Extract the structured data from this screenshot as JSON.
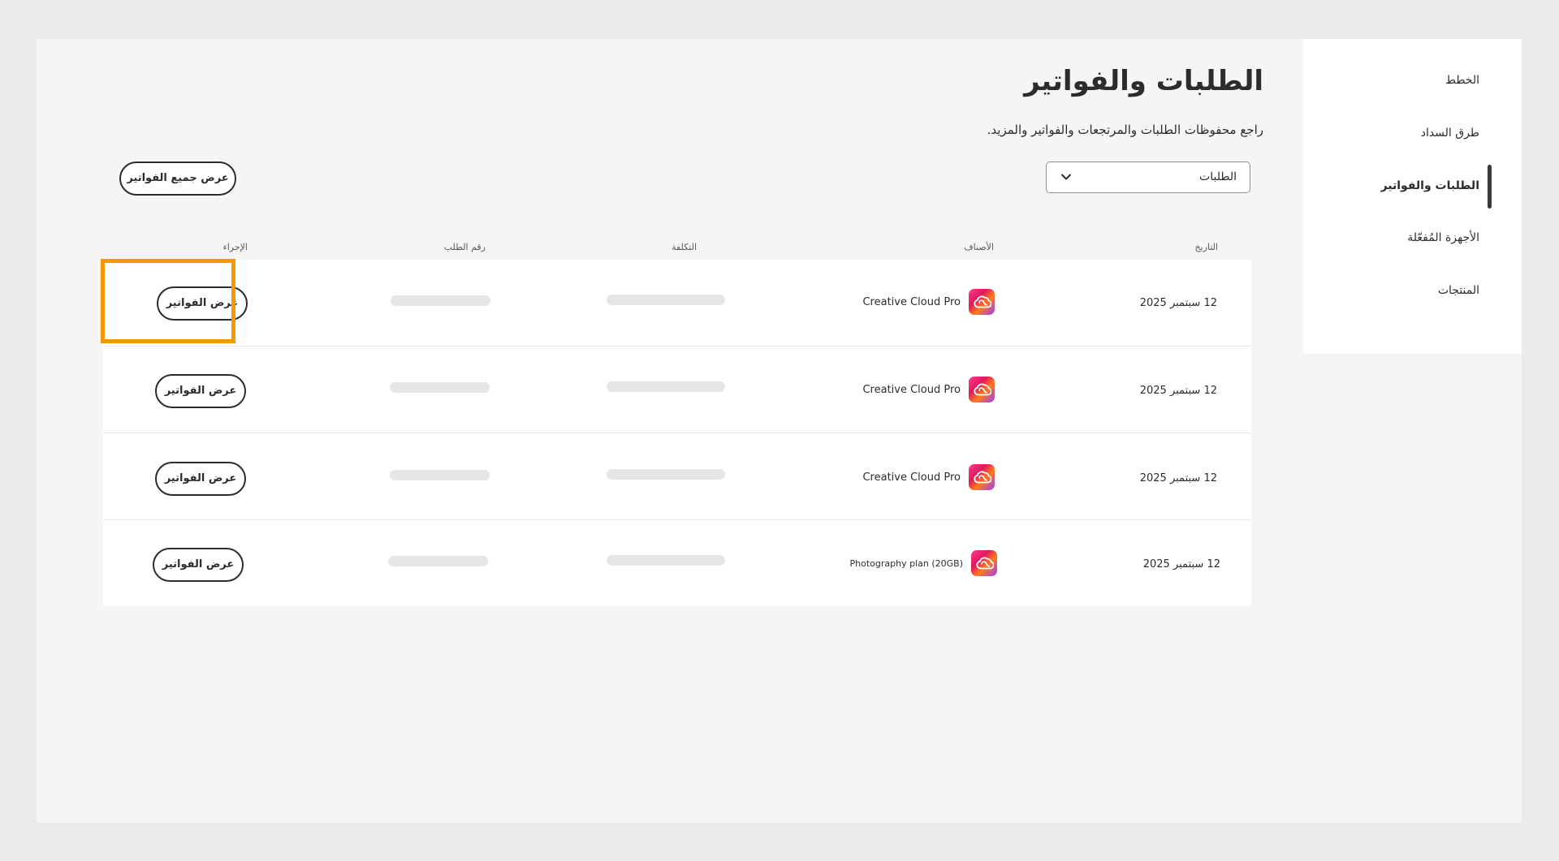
{
  "sidebar": {
    "items": [
      {
        "label": "الخطط",
        "active": false
      },
      {
        "label": "طرق السداد",
        "active": false
      },
      {
        "label": "الطلبات والفواتير",
        "active": true
      },
      {
        "label": "الأجهزة المُفعّلة",
        "active": false
      },
      {
        "label": "المنتجات",
        "active": false
      }
    ]
  },
  "header": {
    "title": "الطلبات والفواتير",
    "subtitle": "راجع محفوظات الطلبات والمرتجعات والفواتير والمزيد."
  },
  "filter": {
    "selected": "الطلبات",
    "icon": "chevron-down-icon"
  },
  "actions": {
    "view_all_invoices": "عرض جميع الفواتير"
  },
  "table": {
    "columns": {
      "date": "التاريخ",
      "items": "الأصناف",
      "cost": "التكلفة",
      "order_number": "رقم الطلب",
      "action": "الإجراء"
    },
    "rows": [
      {
        "date": "12 سبتمبر 2025",
        "item": "Creative Cloud Pro",
        "icon": "creative-cloud-icon",
        "action": "عرض الفواتير"
      },
      {
        "date": "12 سبتمبر 2025",
        "item": "Creative Cloud Pro",
        "icon": "creative-cloud-icon",
        "action": "عرض الفواتير"
      },
      {
        "date": "12 سبتمبر 2025",
        "item": "Creative Cloud Pro",
        "icon": "creative-cloud-icon",
        "action": "عرض الفواتير"
      },
      {
        "date": "12 سبتمبر 2025",
        "item": "Photography plan (20GB)",
        "icon": "creative-cloud-icon",
        "action": "عرض الفواتير"
      }
    ]
  },
  "colors": {
    "highlight": "#f5960b",
    "text": "#2c2c2c",
    "skeleton": "#e6e6e6"
  }
}
